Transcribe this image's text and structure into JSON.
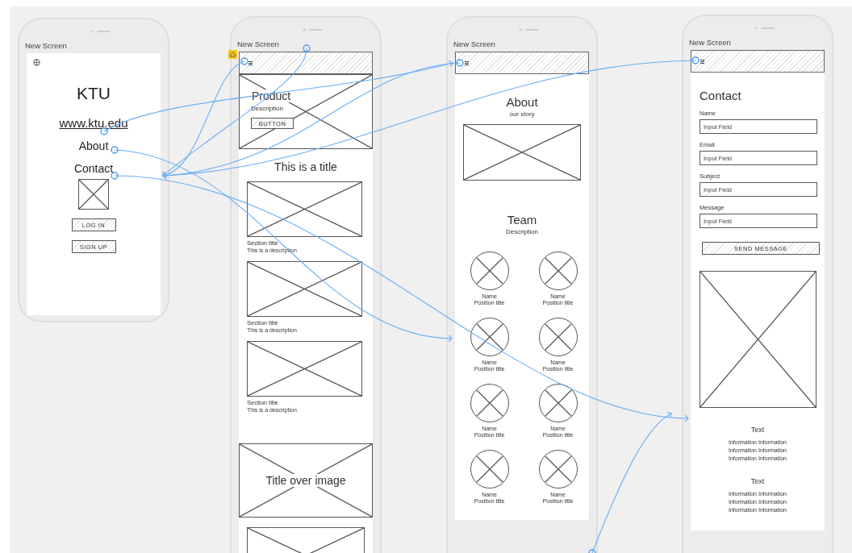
{
  "screens": [
    {
      "title": "New Screen",
      "start": false,
      "blocks": [
        {
          "kind": "icon"
        },
        {
          "kind": "logo",
          "text": "KTU"
        },
        {
          "kind": "url",
          "text": "www.ktu.edu"
        },
        {
          "kind": "nav",
          "text": "About"
        },
        {
          "kind": "nav",
          "text": "Contact"
        },
        {
          "kind": "thumb"
        },
        {
          "kind": "button",
          "text": "LOG IN"
        },
        {
          "kind": "button",
          "text": "SIGN UP"
        }
      ]
    },
    {
      "title": "New Screen",
      "start": true,
      "blocks": [
        {
          "kind": "header"
        },
        {
          "kind": "hero",
          "title": "Product",
          "subtitle": "Description",
          "button": "BUTTON"
        },
        {
          "kind": "title",
          "text": "This is a title"
        },
        {
          "kind": "section",
          "title": "Section title",
          "text": "This is a description"
        },
        {
          "kind": "section",
          "title": "Section title",
          "text": "This is a description"
        },
        {
          "kind": "section",
          "title": "Section title",
          "text": "This is a description"
        },
        {
          "kind": "banner",
          "text": "Title over image"
        },
        {
          "kind": "image"
        }
      ]
    },
    {
      "title": "New Screen",
      "start": false,
      "blocks": [
        {
          "kind": "header"
        },
        {
          "kind": "heading",
          "text": "About"
        },
        {
          "kind": "subtitle",
          "text": "our story"
        },
        {
          "kind": "image"
        },
        {
          "kind": "heading",
          "text": "Team"
        },
        {
          "kind": "subtitle",
          "text": "Description"
        },
        {
          "kind": "team",
          "members": [
            {
              "name": "Name",
              "role": "Position title"
            },
            {
              "name": "Name",
              "role": "Position title"
            },
            {
              "name": "Name",
              "role": "Position title"
            },
            {
              "name": "Name",
              "role": "Position title"
            },
            {
              "name": "Name",
              "role": "Position title"
            },
            {
              "name": "Name",
              "role": "Position title"
            },
            {
              "name": "Name",
              "role": "Position title"
            },
            {
              "name": "Name",
              "role": "Position title"
            }
          ]
        }
      ]
    },
    {
      "title": "New Screen",
      "start": false,
      "blocks": [
        {
          "kind": "header"
        },
        {
          "kind": "heading-left",
          "text": "Contact"
        },
        {
          "kind": "field",
          "label": "Name",
          "placeholder": "Input Field"
        },
        {
          "kind": "field",
          "label": "Email",
          "placeholder": "Input Field"
        },
        {
          "kind": "field",
          "label": "Subject",
          "placeholder": "Input Field"
        },
        {
          "kind": "field",
          "label": "Message",
          "placeholder": "Input Field"
        },
        {
          "kind": "wide-button",
          "text": "SEND MESSAGE"
        },
        {
          "kind": "tall-image"
        },
        {
          "kind": "info",
          "title": "Text",
          "lines": [
            "Information Information",
            "Information Information",
            "Information Information"
          ]
        },
        {
          "kind": "info",
          "title": "Text",
          "lines": [
            "Information Information",
            "Information Information",
            "Information Information"
          ]
        }
      ]
    }
  ]
}
